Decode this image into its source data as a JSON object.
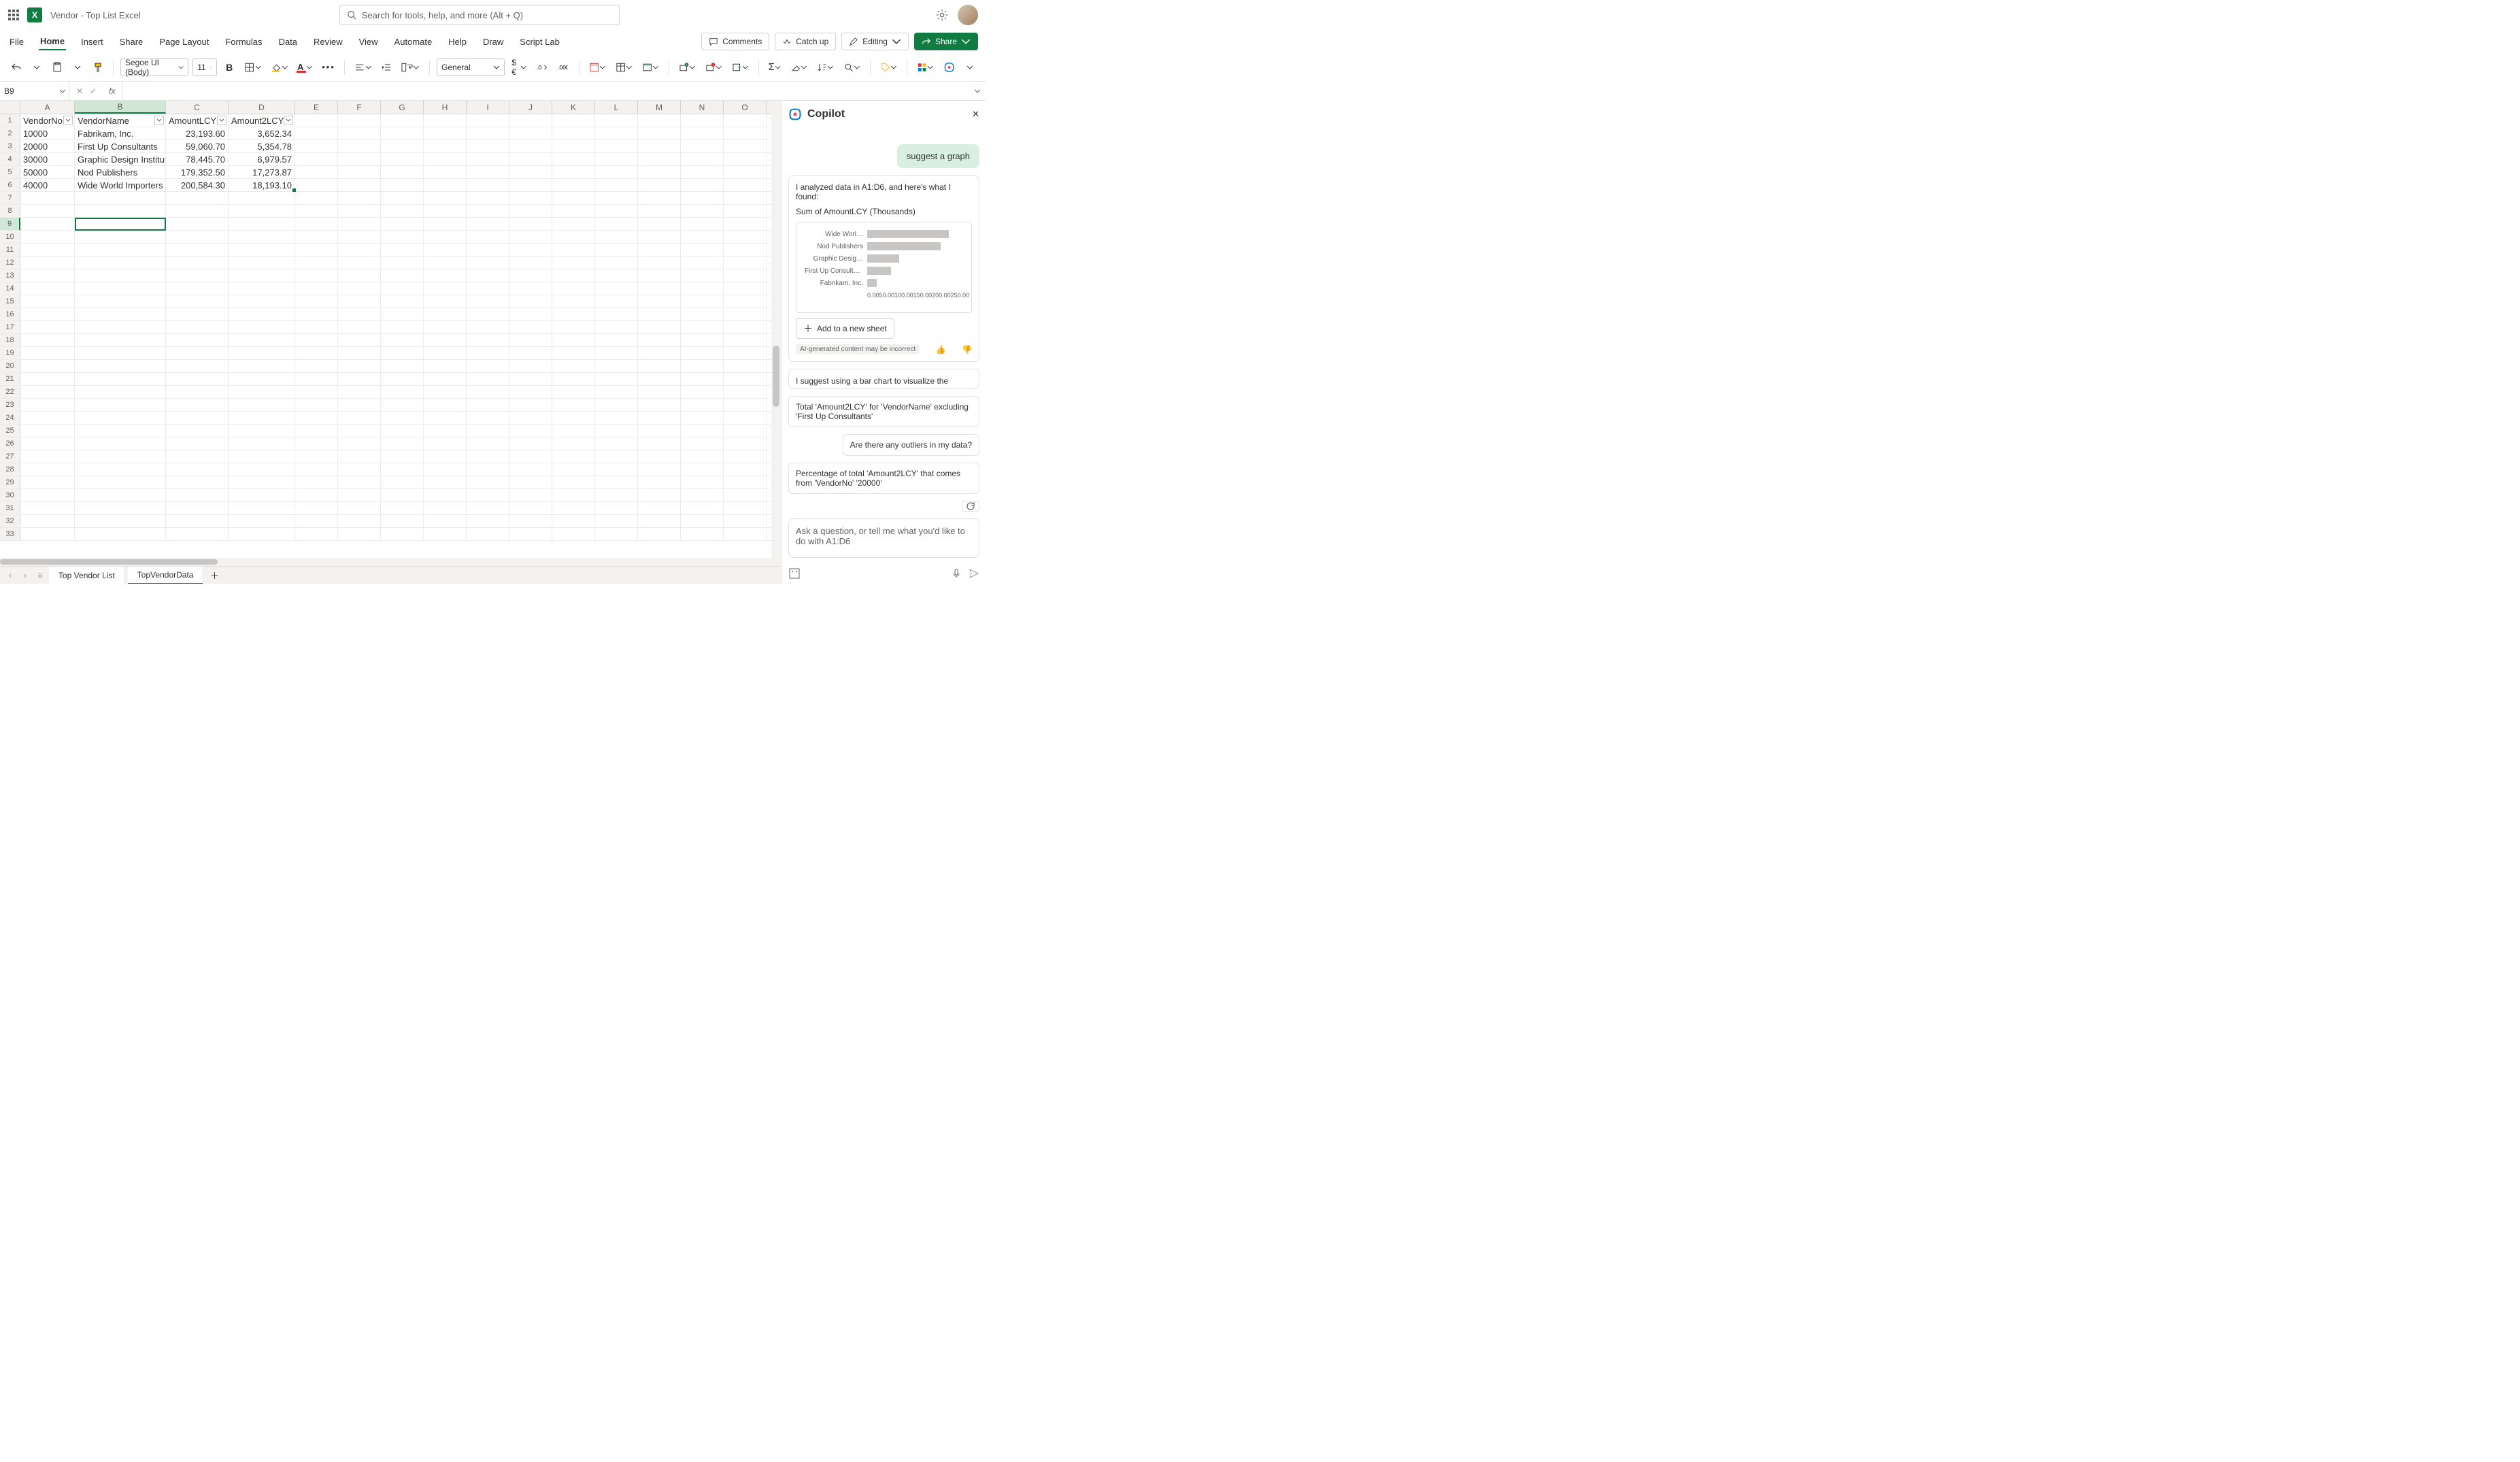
{
  "titlebar": {
    "doc_title": "Vendor - Top List Excel",
    "search_placeholder": "Search for tools, help, and more (Alt + Q)"
  },
  "menu": {
    "tabs": [
      "File",
      "Home",
      "Insert",
      "Share",
      "Page Layout",
      "Formulas",
      "Data",
      "Review",
      "View",
      "Automate",
      "Help",
      "Draw",
      "Script Lab"
    ],
    "active": "Home",
    "comments": "Comments",
    "catch_up": "Catch up",
    "editing": "Editing",
    "share": "Share"
  },
  "ribbon": {
    "font_name": "Segoe UI (Body)",
    "font_size": "11",
    "number_format": "General"
  },
  "namebox": {
    "ref": "B9"
  },
  "columns": [
    "A",
    "B",
    "C",
    "D",
    "E",
    "F",
    "G",
    "H",
    "I",
    "J",
    "K",
    "L",
    "M",
    "N",
    "O"
  ],
  "table": {
    "headers": [
      "VendorNo",
      "VendorName",
      "AmountLCY",
      "Amount2LCY"
    ],
    "rows": [
      {
        "no": "10000",
        "name": "Fabrikam, Inc.",
        "a1": "23,193.60",
        "a2": "3,652.34"
      },
      {
        "no": "20000",
        "name": "First Up Consultants",
        "a1": "59,060.70",
        "a2": "5,354.78"
      },
      {
        "no": "30000",
        "name": "Graphic Design Institute",
        "a1": "78,445.70",
        "a2": "6,979.57"
      },
      {
        "no": "50000",
        "name": "Nod Publishers",
        "a1": "179,352.50",
        "a2": "17,273.87"
      },
      {
        "no": "40000",
        "name": "Wide World Importers",
        "a1": "200,584.30",
        "a2": "18,193.10"
      }
    ]
  },
  "sheets": {
    "tabs": [
      "Top Vendor List",
      "TopVendorData"
    ],
    "active": "TopVendorData"
  },
  "copilot": {
    "title": "Copilot",
    "user_msg": "suggest a graph",
    "analysis_1": "I analyzed data in A1:D6, and here's what I found:",
    "analysis_2": "Sum of AmountLCY (Thousands)",
    "chart_ticks": [
      "0.00",
      "50.00",
      "100.00",
      "150.00",
      "200.00",
      "250.00"
    ],
    "add_btn": "Add to a new sheet",
    "disclaimer": "AI-generated content may be incorrect",
    "suggest_text": "I suggest using a bar chart to visualize the",
    "pill1": "Total 'Amount2LCY' for 'VendorName' excluding 'First Up Consultants'",
    "pill2": "Are there any outliers in my data?",
    "pill3": "Percentage of total 'Amount2LCY' that comes from 'VendorNo' '20000'",
    "input_placeholder": "Ask a question, or tell me what you'd like to do with A1:D6"
  },
  "chart_data": {
    "type": "bar",
    "orientation": "horizontal",
    "title": "Sum of AmountLCY (Thousands)",
    "xlabel": "",
    "ylabel": "",
    "xlim": [
      0,
      250
    ],
    "categories": [
      "Wide Worl…",
      "Nod Publishers",
      "Graphic Desig…",
      "First Up Consultants",
      "Fabrikam, Inc."
    ],
    "values": [
      200.58,
      179.35,
      78.45,
      59.06,
      23.19
    ]
  }
}
